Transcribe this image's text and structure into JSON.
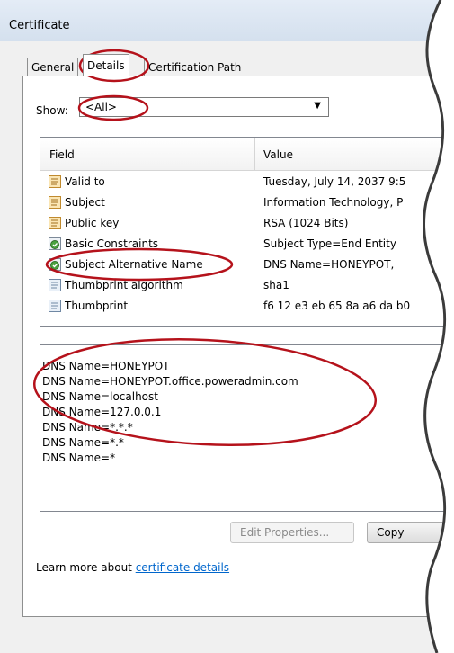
{
  "window": {
    "title": "Certificate"
  },
  "tabs": [
    {
      "label": "General"
    },
    {
      "label": "Details"
    },
    {
      "label": "Certification Path"
    }
  ],
  "show": {
    "label": "Show:",
    "value": "<All>"
  },
  "list": {
    "columns": {
      "field": "Field",
      "value": "Value"
    },
    "rows": [
      {
        "field": "Valid to",
        "value": "Tuesday, July 14, 2037 9:5",
        "icon": "certificate-field-icon"
      },
      {
        "field": "Subject",
        "value": "Information Technology, P",
        "icon": "certificate-field-icon"
      },
      {
        "field": "Public key",
        "value": "RSA (1024 Bits)",
        "icon": "certificate-field-icon"
      },
      {
        "field": "Basic Constraints",
        "value": "Subject Type=End Entity",
        "icon": "extension-icon"
      },
      {
        "field": "Subject Alternative Name",
        "value": "DNS Name=HONEYPOT,",
        "icon": "extension-icon"
      },
      {
        "field": "Thumbprint algorithm",
        "value": "sha1",
        "icon": "property-icon"
      },
      {
        "field": "Thumbprint",
        "value": "f6 12 e3 eb 65 8a a6 da b0",
        "icon": "property-icon"
      }
    ]
  },
  "detail_lines": [
    "DNS Name=HONEYPOT",
    "DNS Name=HONEYPOT.office.poweradmin.com",
    "DNS Name=localhost",
    "DNS Name=127.0.0.1",
    "DNS Name=*.*.*",
    "DNS Name=*.*",
    "DNS Name=*"
  ],
  "buttons": {
    "edit_properties": "Edit Properties...",
    "copy": "Copy"
  },
  "learn": {
    "prefix": "Learn more about ",
    "link": "certificate details"
  },
  "colors": {
    "annotation_red": "#b5121b",
    "link_blue": "#0066cc"
  }
}
